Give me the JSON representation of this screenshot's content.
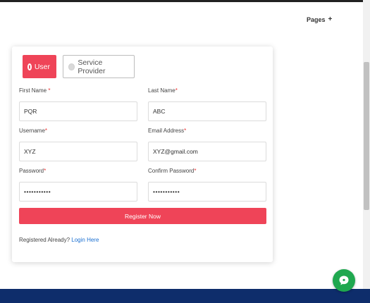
{
  "header": {
    "nav_pages_label": "Pages",
    "nav_pages_icon": "+"
  },
  "role_tabs": [
    {
      "label": "User",
      "selected": true
    },
    {
      "label": "Service Provider",
      "selected": false
    }
  ],
  "form": {
    "first_name": {
      "label": "First Name",
      "required": "*",
      "value": "PQR"
    },
    "last_name": {
      "label": "Last Name",
      "required": "*",
      "value": "ABC"
    },
    "username": {
      "label": "Username",
      "required": "*",
      "value": "XYZ"
    },
    "email": {
      "label": "Email Address",
      "required": "*",
      "value": "XYZ@gmail.com"
    },
    "password": {
      "label": "Password",
      "required": "*",
      "value": "•••••••••••"
    },
    "confirm_password": {
      "label": "Confirm Password",
      "required": "*",
      "value": "•••••••••••"
    },
    "submit_label": "Register Now",
    "login_prompt": "Registered Already?",
    "login_link": "Login Here"
  },
  "colors": {
    "accent": "#ef4458",
    "footer": "#0e2d6b",
    "chat": "#1fa84f",
    "link": "#1a6fd1"
  },
  "icons": {
    "chat": "chat-bubble-icon"
  }
}
